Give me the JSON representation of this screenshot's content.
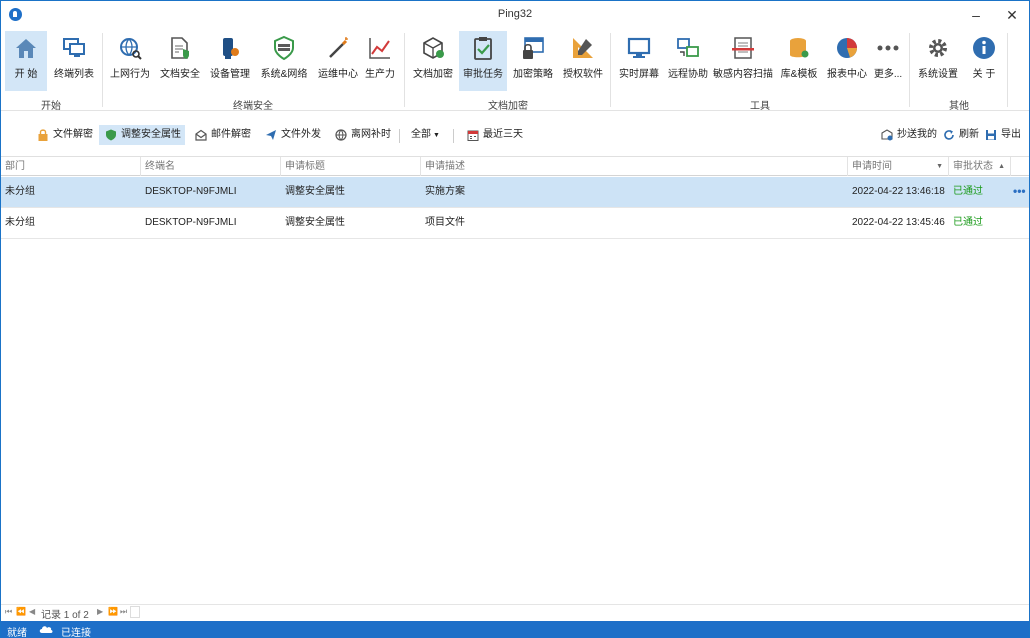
{
  "window": {
    "title": "Ping32",
    "minimize": "–",
    "maximize": "☐",
    "close": "✕"
  },
  "ribbon": {
    "groups": {
      "start": "开始",
      "terminal_security": "终端安全",
      "doc_encryption": "文档加密",
      "tools": "工具",
      "other": "其他"
    },
    "buttons": {
      "home": "开 始",
      "terminal_list": "终端列表",
      "web_behavior": "上网行为",
      "doc_security": "文档安全",
      "device_mgmt": "设备管理",
      "system_network": "系统&网络",
      "ops_center": "运维中心",
      "productivity": "生产力",
      "doc_encrypt": "文档加密",
      "approval_tasks": "审批任务",
      "encrypt_policy": "加密策略",
      "authorized_software": "授权软件",
      "realtime_screen": "实时屏幕",
      "remote_assist": "远程协助",
      "sensitive_scan": "敏感内容扫描",
      "library_template": "库&模板",
      "report_center": "报表中心",
      "more": "更多...",
      "system_settings": "系统设置",
      "about": "关 于"
    }
  },
  "subbar": {
    "file_decrypt": "文件解密",
    "adjust_security": "调整安全属性",
    "mail_decrypt": "邮件解密",
    "file_outgoing": "文件外发",
    "offline_patch": "离网补时",
    "all": "全部",
    "last_three_days": "最近三天",
    "cc_mine": "抄送我的",
    "refresh": "刷新",
    "export": "导出"
  },
  "table": {
    "headers": {
      "dept": "部门",
      "terminal": "终端名",
      "req_title": "申请标题",
      "req_desc": "申请描述",
      "req_time": "申请时间",
      "status": "审批状态"
    },
    "rows": [
      {
        "dept": "未分组",
        "terminal": "DESKTOP-N9FJMLI",
        "title": "调整安全属性",
        "desc": "实施方案",
        "time": "2022-04-22 13:46:18",
        "status": "已通过"
      },
      {
        "dept": "未分组",
        "terminal": "DESKTOP-N9FJMLI",
        "title": "调整安全属性",
        "desc": "项目文件",
        "time": "2022-04-22 13:45:46",
        "status": "已通过"
      }
    ],
    "row_more": "•••"
  },
  "pager": {
    "record_text": "记录 1 of 2"
  },
  "status": {
    "ready": "就绪",
    "connected": "已连接"
  },
  "colors": {
    "accent": "#1e6fc8",
    "selected_row": "#cde3f6",
    "status_ok": "#1a9a1a"
  }
}
